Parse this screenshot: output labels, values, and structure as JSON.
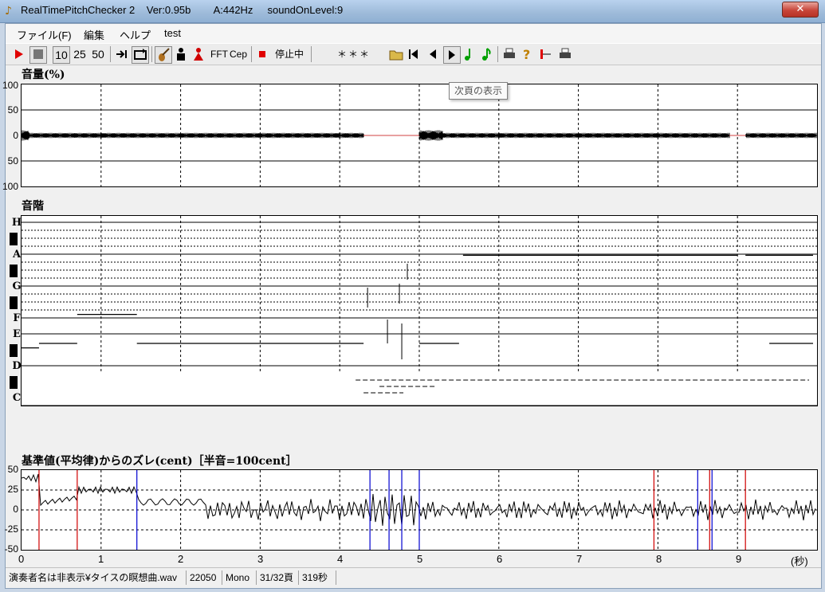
{
  "window": {
    "title": "RealTimePitchChecker 2    Ver:0.95b        A:442Hz     soundOnLevel:9",
    "close_glyph": "✕"
  },
  "menu": [
    "ファイル(F)",
    "編集",
    "ヘルプ",
    "test"
  ],
  "toolbar": {
    "speed_options": [
      "10",
      "25",
      "50"
    ],
    "fft_label": "FFT",
    "cep_label": "Cep",
    "status_text": "停止中",
    "indicator_text": "＊＊＊"
  },
  "tooltip": "次頁の表示",
  "volume": {
    "title": "音量(%)",
    "y_ticks": [
      "100",
      "50",
      "0",
      "50",
      "100"
    ]
  },
  "scale": {
    "title": "音階",
    "notes": [
      "H",
      "A",
      "G",
      "F",
      "E",
      "D",
      "C"
    ]
  },
  "cent": {
    "title": "基準値(平均律)からのズレ(cent)［半音=100cent］",
    "y_ticks": [
      "50",
      "25",
      "0",
      "-25",
      "-50"
    ]
  },
  "x_axis": {
    "ticks": [
      "0",
      "1",
      "2",
      "3",
      "4",
      "5",
      "6",
      "7",
      "8",
      "9"
    ],
    "unit": "(秒)"
  },
  "chart_data": [
    {
      "type": "line",
      "title": "音量(%)",
      "y_ticks": [
        "100",
        "50",
        "0",
        "50",
        "100"
      ],
      "xlim": [
        0,
        10
      ],
      "ylim": [
        -100,
        100
      ],
      "grid": true
    },
    {
      "type": "line",
      "title": "音階",
      "y_tick_labels": [
        "C",
        "D",
        "E",
        "F",
        "G",
        "A",
        "H"
      ],
      "xlim": [
        0,
        10
      ],
      "grid": true,
      "note_segments": [
        {
          "x": [
            0.0,
            0.22
          ],
          "note_pos": 0.8
        },
        {
          "x": [
            0.22,
            0.7
          ],
          "note_pos": 1.0
        },
        {
          "x": [
            0.7,
            1.45
          ],
          "note_pos": 2.3
        },
        {
          "x": [
            1.45,
            4.3
          ],
          "note_pos": 1.0
        },
        {
          "x": [
            5.0,
            5.5
          ],
          "note_pos": 1.0
        },
        {
          "x": [
            5.55,
            9.0
          ],
          "note_pos": 4.95
        },
        {
          "x": [
            9.1,
            9.95
          ],
          "note_pos": 4.95
        },
        {
          "x": [
            9.4,
            9.95
          ],
          "note_pos": 1.0
        }
      ]
    },
    {
      "type": "line",
      "title": "基準値(平均律)からのズレ(cent)［半音=100cent］",
      "ylabel": "cent",
      "xlim": [
        0,
        10
      ],
      "ylim": [
        -50,
        50
      ],
      "y_ticks": [
        50,
        25,
        0,
        -25,
        -50
      ],
      "grid": true,
      "red_markers_x": [
        0.22,
        0.7,
        7.95,
        8.65,
        9.1
      ],
      "blue_markers_x": [
        1.45,
        4.38,
        4.62,
        4.78,
        5.0,
        8.5,
        8.68
      ]
    }
  ],
  "statusbar": [
    "演奏者名は非表示¥タイスの瞑想曲.wav",
    "22050",
    "Mono",
    "31/32頁",
    "319秒"
  ]
}
